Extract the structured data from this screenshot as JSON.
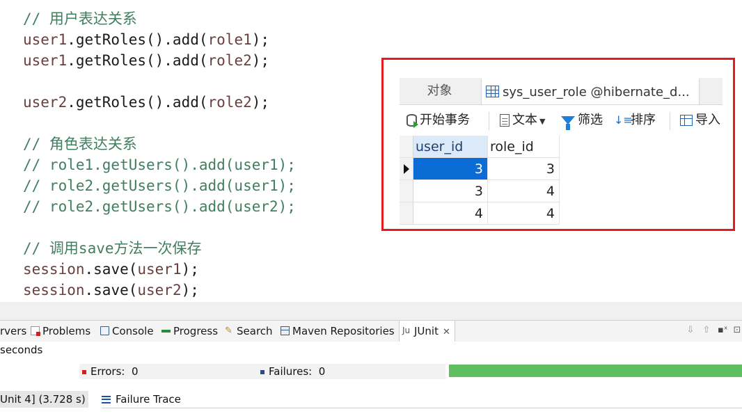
{
  "editor": {
    "lines": [
      {
        "kind": "comment",
        "text": "// 用户表达关系"
      },
      {
        "kind": "code",
        "obj": "user1",
        "mid": ".getRoles().add(",
        "arg": "role1",
        "end": ");"
      },
      {
        "kind": "code",
        "obj": "user1",
        "mid": ".getRoles().add(",
        "arg": "role2",
        "end": ");"
      },
      {
        "kind": "code",
        "obj": "user2",
        "mid": ".getRoles().add(",
        "arg": "role2",
        "end": ");"
      },
      {
        "kind": "comment",
        "text": "// 角色表达关系"
      },
      {
        "kind": "comment",
        "text": "// role1.getUsers().add(user1);"
      },
      {
        "kind": "comment",
        "text": "// role2.getUsers().add(user1);"
      },
      {
        "kind": "comment",
        "text": "// role2.getUsers().add(user2);"
      },
      {
        "kind": "comment",
        "text": "// 调用save方法一次保存"
      },
      {
        "kind": "code",
        "obj": "session",
        "mid": ".save(",
        "arg": "user1",
        "end": ");"
      },
      {
        "kind": "code",
        "obj": "session",
        "mid": ".save(",
        "arg": "user2",
        "end": ");"
      }
    ]
  },
  "navicat": {
    "tabs": {
      "objects": "对象",
      "table": "sys_user_role @hibernate_d..."
    },
    "toolbar": {
      "begin_transaction": "开始事务",
      "text": "文本",
      "filter": "筛选",
      "sort": "排序",
      "import": "导入"
    },
    "grid": {
      "columns": [
        "user_id",
        "role_id"
      ],
      "rows": [
        [
          "3",
          "3"
        ],
        [
          "3",
          "4"
        ],
        [
          "4",
          "4"
        ]
      ],
      "selected_row": 0
    },
    "highlight_color": "#e21b1b"
  },
  "eclipse": {
    "views": {
      "servers": "rvers",
      "problems": "Problems",
      "console": "Console",
      "progress": "Progress",
      "search": "Search",
      "maven": "Maven Repositories",
      "junit": "JUnit"
    },
    "junit": {
      "time_text": "seconds",
      "errors_label": "Errors:",
      "errors_value": "0",
      "failures_label": "Failures:",
      "failures_value": "0",
      "progress_color": "#5fbf5f",
      "tree_item": "Unit 4] (3.728 s)",
      "failure_trace": "Failure Trace"
    }
  }
}
